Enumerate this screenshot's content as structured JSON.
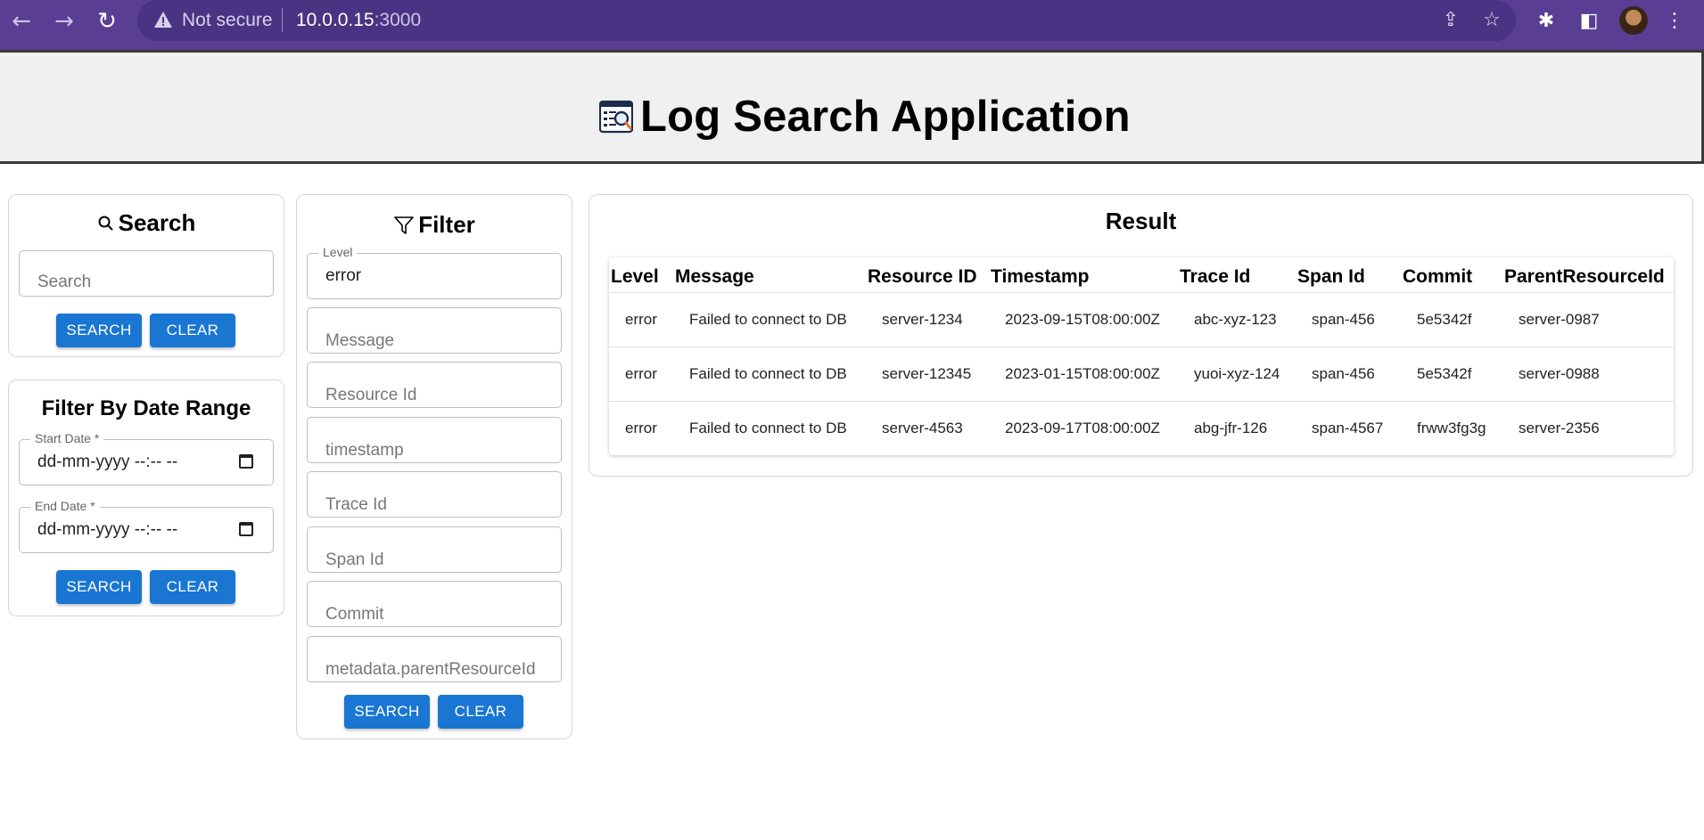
{
  "browser": {
    "security_label": "Not secure",
    "url_host": "10.0.0.15",
    "url_port": ":3000"
  },
  "app": {
    "title": "Log Search Application"
  },
  "search_panel": {
    "title": "Search",
    "search_placeholder": "Search",
    "search_button": "SEARCH",
    "clear_button": "CLEAR"
  },
  "date_panel": {
    "title": "Filter By Date Range",
    "start_label": "Start Date *",
    "start_value": "dd-mm-yyyy --:-- --",
    "end_label": "End Date *",
    "end_value": "dd-mm-yyyy --:-- --",
    "search_button": "SEARCH",
    "clear_button": "CLEAR"
  },
  "filter_panel": {
    "title": "Filter",
    "level_label": "Level",
    "level_value": "error",
    "message_placeholder": "Message",
    "resource_placeholder": "Resource Id",
    "timestamp_placeholder": "timestamp",
    "trace_placeholder": "Trace Id",
    "span_placeholder": "Span Id",
    "commit_placeholder": "Commit",
    "parent_placeholder": "metadata.parentResourceId",
    "search_button": "SEARCH",
    "clear_button": "CLEAR"
  },
  "result": {
    "title": "Result",
    "columns": [
      "Level",
      "Message",
      "Resource ID",
      "Timestamp",
      "Trace Id",
      "Span Id",
      "Commit",
      "ParentResourceId"
    ],
    "rows": [
      [
        "error",
        "Failed to connect to DB",
        "server-1234",
        "2023-09-15T08:00:00Z",
        "abc-xyz-123",
        "span-456",
        "5e5342f",
        "server-0987"
      ],
      [
        "error",
        "Failed to connect to DB",
        "server-12345",
        "2023-01-15T08:00:00Z",
        "yuoi-xyz-124",
        "span-456",
        "5e5342f",
        "server-0988"
      ],
      [
        "error",
        "Failed to connect to DB",
        "server-4563",
        "2023-09-17T08:00:00Z",
        "abg-jfr-126",
        "span-4567",
        "frww3fg3g",
        "server-2356"
      ]
    ]
  }
}
